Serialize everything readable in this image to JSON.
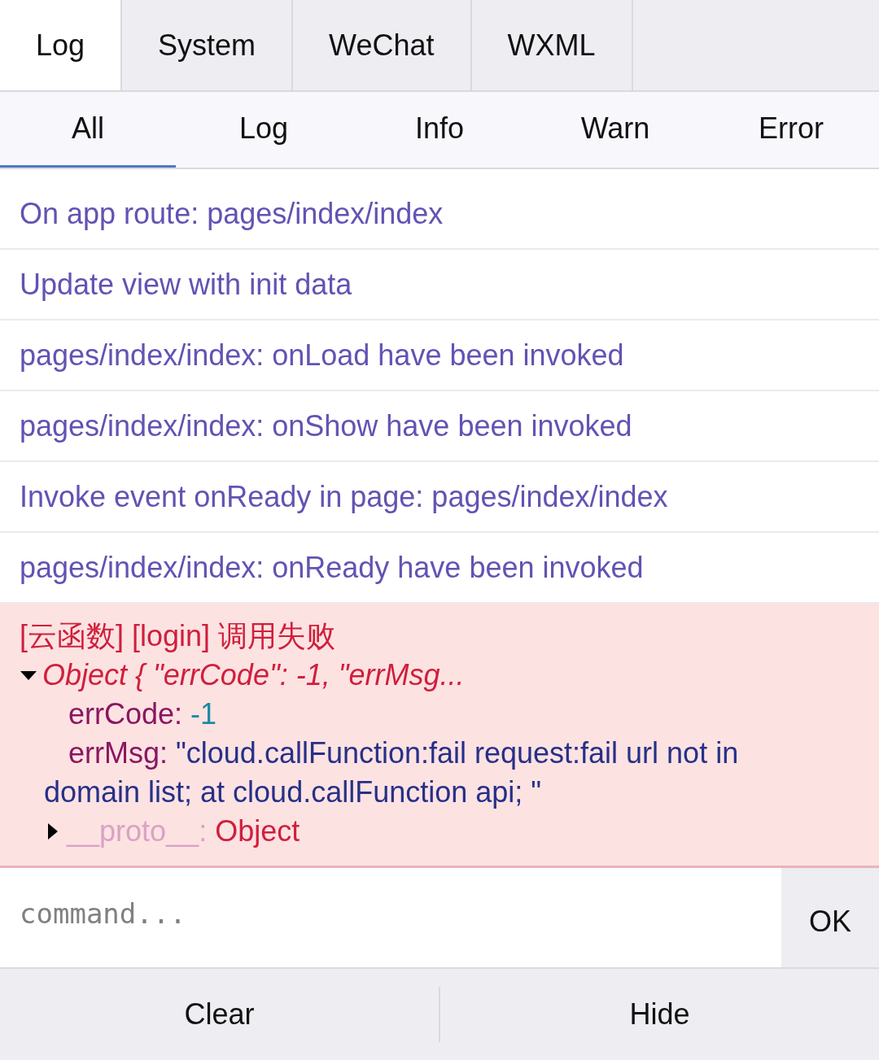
{
  "tabs": [
    {
      "label": "Log",
      "selected": true
    },
    {
      "label": "System",
      "selected": false
    },
    {
      "label": "WeChat",
      "selected": false
    },
    {
      "label": "WXML",
      "selected": false
    }
  ],
  "filters": [
    {
      "label": "All",
      "selected": true
    },
    {
      "label": "Log",
      "selected": false
    },
    {
      "label": "Info",
      "selected": false
    },
    {
      "label": "Warn",
      "selected": false
    },
    {
      "label": "Error",
      "selected": false
    }
  ],
  "logs": [
    {
      "kind": "log",
      "text": "On app route: pages/index/index"
    },
    {
      "kind": "log",
      "text": "Update view with init data"
    },
    {
      "kind": "log",
      "text": "pages/index/index: onLoad have been invoked"
    },
    {
      "kind": "log",
      "text": "pages/index/index: onShow have been invoked"
    },
    {
      "kind": "log",
      "text": "Invoke event onReady in page: pages/index/index"
    },
    {
      "kind": "log",
      "text": "pages/index/index: onReady have been invoked"
    },
    {
      "kind": "error",
      "text": "[云函数] [login] 调用失败",
      "object": {
        "summary": "Object { \"errCode\": -1, \"errMsg...",
        "expanded": true,
        "properties": [
          {
            "kind": "number",
            "key": "errCode:",
            "value": "-1"
          },
          {
            "kind": "string",
            "key": "errMsg:",
            "value": "\"cloud.callFunction:fail request:fail url not in domain list; at cloud.callFunction api; \""
          },
          {
            "kind": "proto",
            "key": "__proto__:",
            "value": "Object",
            "expanded": false
          }
        ]
      }
    }
  ],
  "command": {
    "placeholder": "command...",
    "button": "OK"
  },
  "footer": [
    "Clear",
    "Hide"
  ]
}
